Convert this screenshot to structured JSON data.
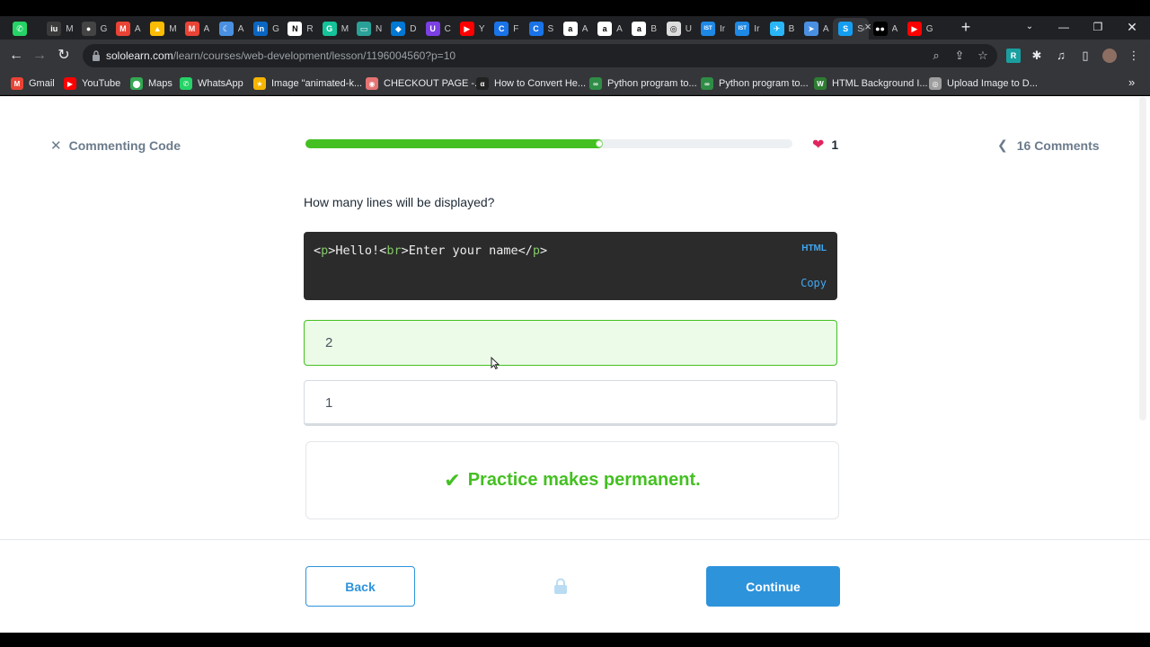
{
  "browser": {
    "tabs": [
      {
        "icon": "whatsapp-icon",
        "color": "#25d366",
        "glyph": "✆",
        "title": ""
      },
      {
        "icon": "iu-icon",
        "color": "#3a3a3a",
        "glyph": "iu",
        "title": "M"
      },
      {
        "icon": "github-icon",
        "color": "#444",
        "glyph": "●",
        "title": "G"
      },
      {
        "icon": "gmail-icon",
        "color": "#ea4335",
        "glyph": "M",
        "title": "A"
      },
      {
        "icon": "drive-icon",
        "color": "#fbbc04",
        "glyph": "▲",
        "title": "M"
      },
      {
        "icon": "gmail-icon",
        "color": "#ea4335",
        "glyph": "M",
        "title": "A"
      },
      {
        "icon": "crescent-icon",
        "color": "#4a90e2",
        "glyph": "☾",
        "title": "A"
      },
      {
        "icon": "linkedin-icon",
        "color": "#0a66c2",
        "glyph": "in",
        "title": "G"
      },
      {
        "icon": "notion-icon",
        "color": "#fff",
        "glyph": "N",
        "title": "R"
      },
      {
        "icon": "grammarly-icon",
        "color": "#15c39a",
        "glyph": "G",
        "title": "M"
      },
      {
        "icon": "battery-icon",
        "color": "#2aa198",
        "glyph": "▭",
        "title": "N"
      },
      {
        "icon": "vscode-icon",
        "color": "#0078d4",
        "glyph": "◆",
        "title": "D"
      },
      {
        "icon": "purple-icon",
        "color": "#7b3fe4",
        "glyph": "U",
        "title": "C"
      },
      {
        "icon": "youtube-icon",
        "color": "#ff0000",
        "glyph": "▶",
        "title": "Y"
      },
      {
        "icon": "c-icon",
        "color": "#1a73e8",
        "glyph": "C",
        "title": "F"
      },
      {
        "icon": "c-icon",
        "color": "#1a73e8",
        "glyph": "C",
        "title": "S"
      },
      {
        "icon": "amazon-icon",
        "color": "#fff",
        "glyph": "a",
        "title": "A"
      },
      {
        "icon": "amazon-icon",
        "color": "#fff",
        "glyph": "a",
        "title": "A"
      },
      {
        "icon": "amazon-icon",
        "color": "#fff",
        "glyph": "a",
        "title": "B"
      },
      {
        "icon": "globe-icon",
        "color": "#ddd",
        "glyph": "◎",
        "title": "U"
      },
      {
        "icon": "ist-icon",
        "color": "#1e88e5",
        "glyph": "IST",
        "title": "Ir"
      },
      {
        "icon": "ist-icon",
        "color": "#1e88e5",
        "glyph": "IST",
        "title": "Ir"
      },
      {
        "icon": "bird-icon",
        "color": "#29b6f6",
        "glyph": "✈",
        "title": "B"
      },
      {
        "icon": "send-icon",
        "color": "#4a90e2",
        "glyph": "➤",
        "title": "A"
      },
      {
        "icon": "sololearn-icon",
        "color": "#149ef2",
        "glyph": "S",
        "title": "Sc",
        "active": true
      },
      {
        "icon": "medium-icon",
        "color": "#000",
        "glyph": "●●",
        "title": "A"
      },
      {
        "icon": "youtube-icon",
        "color": "#ff0000",
        "glyph": "▶",
        "title": "G"
      }
    ],
    "address": {
      "host": "sololearn.com",
      "path": "/learn/courses/web-development/lesson/1196004560?p=10"
    },
    "bookmarks": [
      {
        "label": "Gmail",
        "icon": "gmail-icon",
        "color": "#ea4335",
        "glyph": "M"
      },
      {
        "label": "YouTube",
        "icon": "youtube-icon",
        "color": "#ff0000",
        "glyph": "▶"
      },
      {
        "label": "Maps",
        "icon": "maps-icon",
        "color": "#34a853",
        "glyph": "⬤"
      },
      {
        "label": "WhatsApp",
        "icon": "whatsapp-icon",
        "color": "#25d366",
        "glyph": "✆"
      },
      {
        "label": "Image \"animated-k...",
        "icon": "star-icon",
        "color": "#f4b400",
        "glyph": "★"
      },
      {
        "label": "CHECKOUT PAGE -...",
        "icon": "pill-icon",
        "color": "#e57373",
        "glyph": "◉"
      },
      {
        "label": "How to Convert He...",
        "icon": "alpha-icon",
        "color": "#222",
        "glyph": "α"
      },
      {
        "label": "Python program to...",
        "icon": "gfg-icon",
        "color": "#2f8d46",
        "glyph": "∞"
      },
      {
        "label": "Python program to...",
        "icon": "gfg-icon",
        "color": "#2f8d46",
        "glyph": "∞"
      },
      {
        "label": "HTML Background I...",
        "icon": "w-icon",
        "color": "#2e7d32",
        "glyph": "W"
      },
      {
        "label": "Upload Image to D...",
        "icon": "globe-icon",
        "color": "#9e9e9e",
        "glyph": "◎"
      }
    ]
  },
  "lesson": {
    "close_label": "Commenting Code",
    "progress": 0.61,
    "hearts": "1",
    "comments_label": "16 Comments",
    "question": "How many lines will be displayed?",
    "code": {
      "language": "HTML",
      "copy_label": "Copy",
      "parts": [
        "<",
        "p",
        ">Hello!<",
        "br",
        ">Enter your name</",
        "p",
        ">"
      ]
    },
    "options": [
      {
        "value": "2",
        "selected": true
      },
      {
        "value": "1",
        "selected": false
      }
    ],
    "feedback": "Practice makes permanent.",
    "back_label": "Back",
    "continue_label": "Continue"
  },
  "colors": {
    "accent": "#2d93db",
    "success": "#44c022",
    "heart": "#e0245e"
  }
}
